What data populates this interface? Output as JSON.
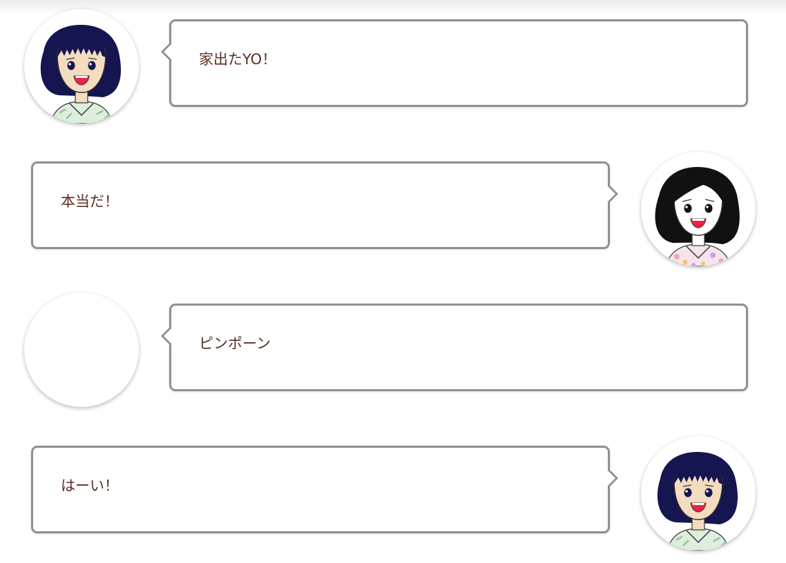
{
  "chat": {
    "messages": [
      {
        "side": "left",
        "avatar": "girl-navy-hair-avatar",
        "text": "家出たYO！"
      },
      {
        "side": "right",
        "avatar": "girl-black-hair-avatar",
        "text": "本当だ！"
      },
      {
        "side": "left",
        "avatar": "blank-avatar",
        "text": "ピンポーン"
      },
      {
        "side": "right",
        "avatar": "girl-navy-hair-avatar",
        "text": "はーい！"
      }
    ]
  },
  "colors": {
    "text": "#5a2f20",
    "bubble_border": "#8f8f8f",
    "background": "#ffffff"
  }
}
